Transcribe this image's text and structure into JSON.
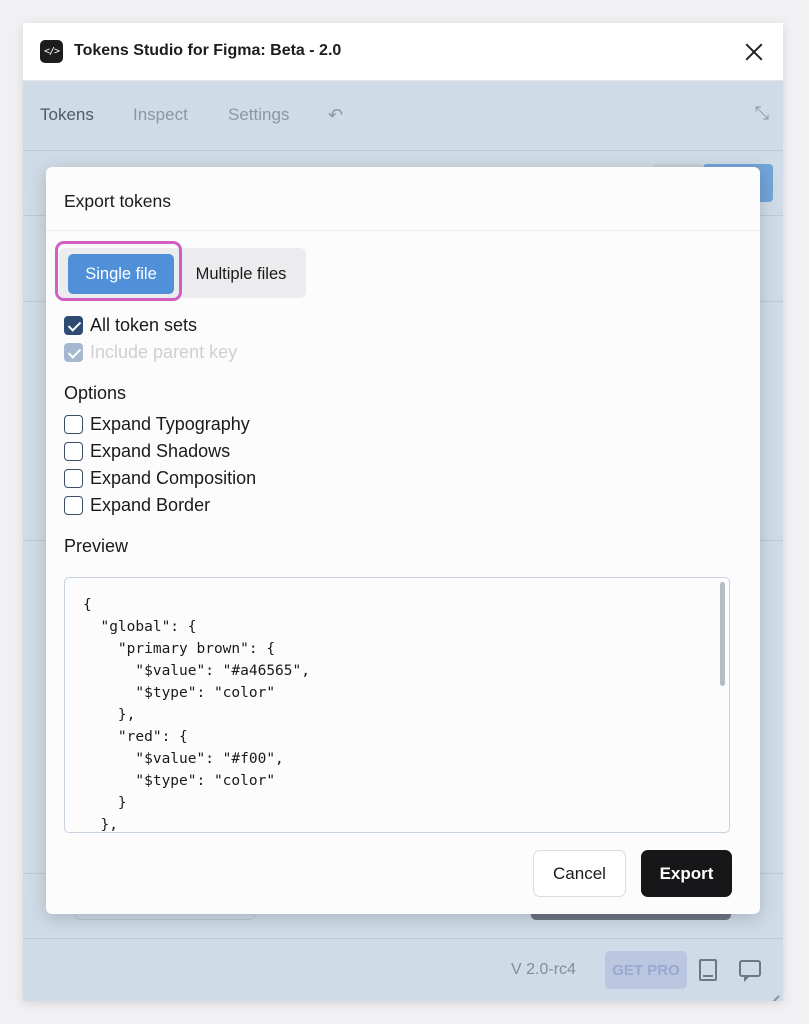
{
  "window": {
    "title": "Tokens Studio for Figma: Beta - 2.0",
    "app_icon_glyph": "</>"
  },
  "nav": {
    "tabs": [
      {
        "label": "Tokens"
      },
      {
        "label": "Inspect"
      },
      {
        "label": "Settings"
      }
    ],
    "undo_icon": "undo-arrow-icon",
    "collapse_icon": "collapse-arrows-icon"
  },
  "status": {
    "version": "V 2.0-rc4",
    "get_pro": "GET PRO",
    "icons": [
      "book-icon",
      "chat-icon"
    ]
  },
  "modal": {
    "title": "Export tokens",
    "mode": {
      "options": [
        "Single file",
        "Multiple files"
      ],
      "selected": "Single file"
    },
    "checkboxes": [
      {
        "label": "All token sets",
        "checked": true,
        "disabled": false
      },
      {
        "label": "Include parent key",
        "checked": true,
        "disabled": true
      }
    ],
    "options_title": "Options",
    "options": [
      {
        "label": "Expand Typography",
        "checked": false
      },
      {
        "label": "Expand Shadows",
        "checked": false
      },
      {
        "label": "Expand Composition",
        "checked": false
      },
      {
        "label": "Expand Border",
        "checked": false
      }
    ],
    "preview_title": "Preview",
    "preview_code": "{\n  \"global\": {\n    \"primary brown\": {\n      \"$value\": \"#a46565\",\n      \"$type\": \"color\"\n    },\n    \"red\": {\n      \"$value\": \"#f00\",\n      \"$type\": \"color\"\n    }\n  },",
    "cancel_label": "Cancel",
    "export_label": "Export"
  },
  "colors": {
    "primary_button": "#4f90d8",
    "focus_ring": "#d05fc4",
    "export_button": "#17171a",
    "checkbox_checked": "#2e4b73"
  }
}
